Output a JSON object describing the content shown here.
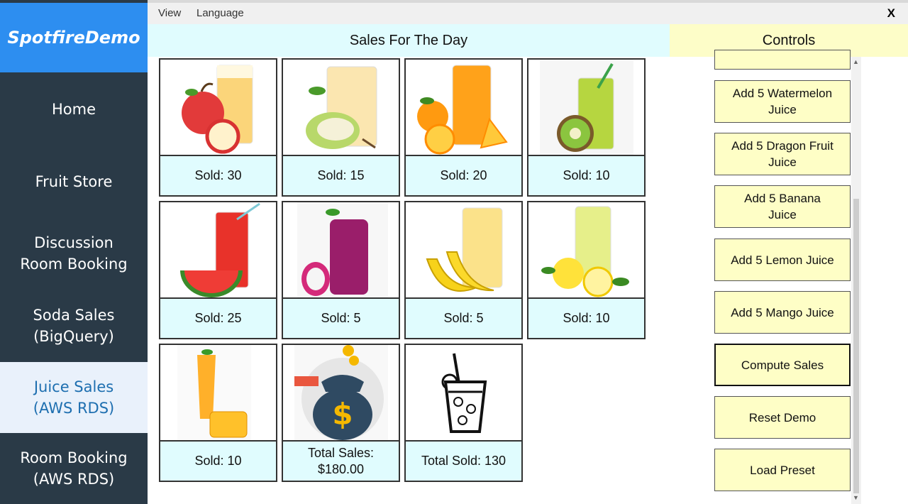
{
  "app": {
    "brand": "SpotfireDemo"
  },
  "sidebar": {
    "items": [
      {
        "label": "Home"
      },
      {
        "label": "Fruit Store"
      },
      {
        "label": "Discussion\nRoom Booking"
      },
      {
        "label": "Soda Sales\n(BigQuery)"
      },
      {
        "label": "Juice Sales\n(AWS RDS)",
        "active": true
      },
      {
        "label": "Room Booking\n(AWS RDS)"
      }
    ]
  },
  "menu": {
    "view": "View",
    "language": "Language",
    "close": "X"
  },
  "sales": {
    "header": "Sales For The Day",
    "tiles": [
      {
        "icon": "apple-juice-image",
        "label": "Sold: 30"
      },
      {
        "icon": "pear-juice-image",
        "label": "Sold: 15"
      },
      {
        "icon": "orange-juice-image",
        "label": "Sold: 20"
      },
      {
        "icon": "kiwi-juice-image",
        "label": "Sold: 10"
      },
      {
        "icon": "watermelon-juice-image",
        "label": "Sold: 25"
      },
      {
        "icon": "dragon-fruit-juice-image",
        "label": "Sold: 5"
      },
      {
        "icon": "banana-juice-image",
        "label": "Sold: 5"
      },
      {
        "icon": "lemon-juice-image",
        "label": "Sold: 10"
      },
      {
        "icon": "mango-juice-image",
        "label": "Sold: 10"
      },
      {
        "icon": "money-bag-icon",
        "label": "Total Sales:\n$180.00"
      },
      {
        "icon": "juice-glass-icon",
        "label": "Total Sold: 130"
      }
    ]
  },
  "controls": {
    "header": "Controls",
    "buttons": [
      {
        "label": "Add 5 Watermelon\nJuice"
      },
      {
        "label": "Add 5 Dragon Fruit\nJuice"
      },
      {
        "label": "Add 5 Banana\nJuice"
      },
      {
        "label": "Add 5 Lemon Juice"
      },
      {
        "label": "Add 5 Mango Juice"
      },
      {
        "label": "Compute Sales"
      },
      {
        "label": "Reset Demo"
      },
      {
        "label": "Load Preset"
      }
    ]
  },
  "colors": {
    "brand_bg": "#2d8ef0",
    "sidebar_bg": "#2a3a47",
    "sales_header_bg": "#e0fcfe",
    "controls_bg": "#fdfdc8"
  }
}
